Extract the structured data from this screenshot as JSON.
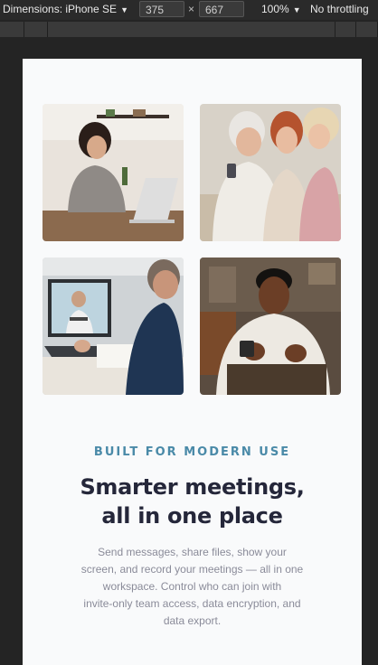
{
  "devtools": {
    "dimensions_label": "Dimensions: iPhone SE",
    "width_value": "375",
    "times_symbol": "×",
    "height_value": "667",
    "zoom_label": "100%",
    "throttling_label": "No throttling",
    "caret": "▼"
  },
  "gallery": {
    "images": [
      {
        "name": "woman-video-call-photo"
      },
      {
        "name": "senior-women-phone-photo"
      },
      {
        "name": "man-laptop-video-call-photo"
      },
      {
        "name": "man-smartphone-photo"
      }
    ]
  },
  "feature": {
    "eyebrow": "BUILT FOR MODERN USE",
    "headline_line1": "Smarter meetings,",
    "headline_line2": "all in one place",
    "body_lines": [
      "Send messages, share files, show your",
      "screen, and record your meetings — all in one",
      "workspace. Control who can join with",
      "invite-only team access, data encryption, and",
      "data export."
    ]
  },
  "colors": {
    "eyebrow": "#4a8aa8",
    "headline": "#25273a",
    "body": "#8a8b99",
    "page_background": "#f9fafb"
  }
}
